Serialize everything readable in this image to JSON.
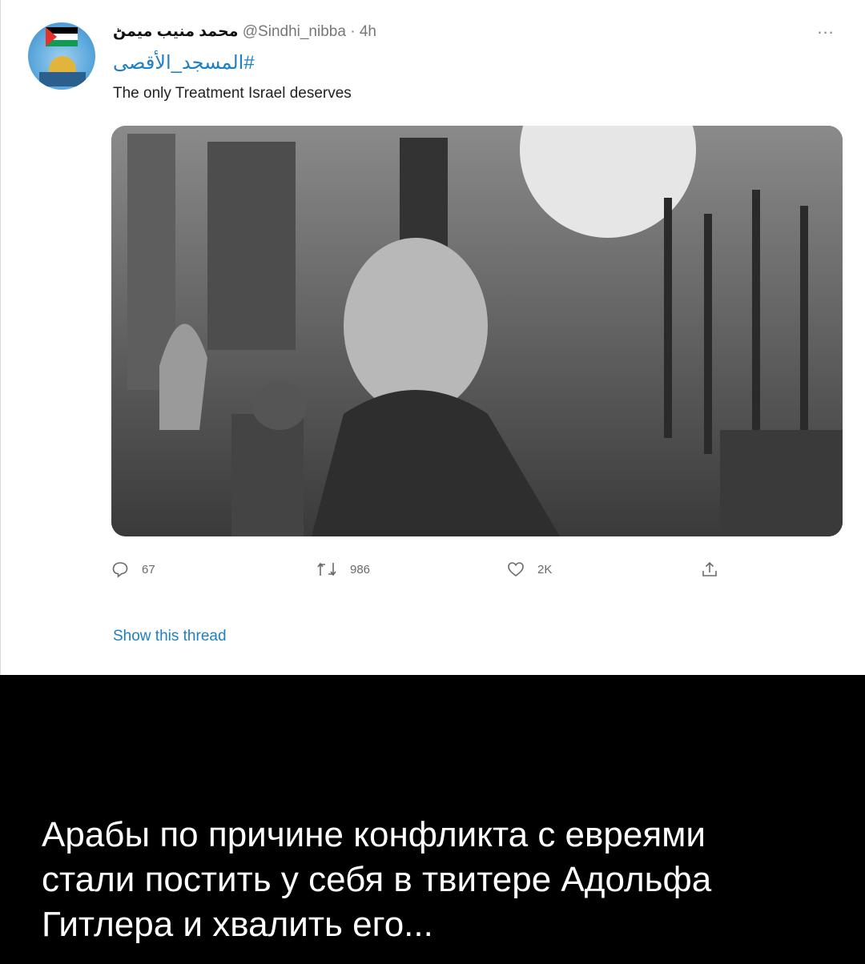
{
  "tweet": {
    "display_name": "محمد منيب ميمڻ",
    "handle": "@Sindhi_nibba",
    "separator": "·",
    "time": "4h",
    "more_glyph": "...",
    "hashtag": "#المسجد_الأقصى",
    "text": "The only Treatment Israel deserves",
    "media_icon": "photo-placeholder",
    "actions": {
      "replies": "67",
      "retweets": "986",
      "likes": "2K"
    },
    "show_thread": "Show this thread"
  },
  "caption": {
    "text": "Арабы по причине конфликта с евреями\nстали постить у себя в твитере Адольфа\nГитлера и хвалить его..."
  },
  "colors": {
    "link": "#1d7fc4",
    "caption_bg": "#000000",
    "caption_text": "#ffffff"
  }
}
